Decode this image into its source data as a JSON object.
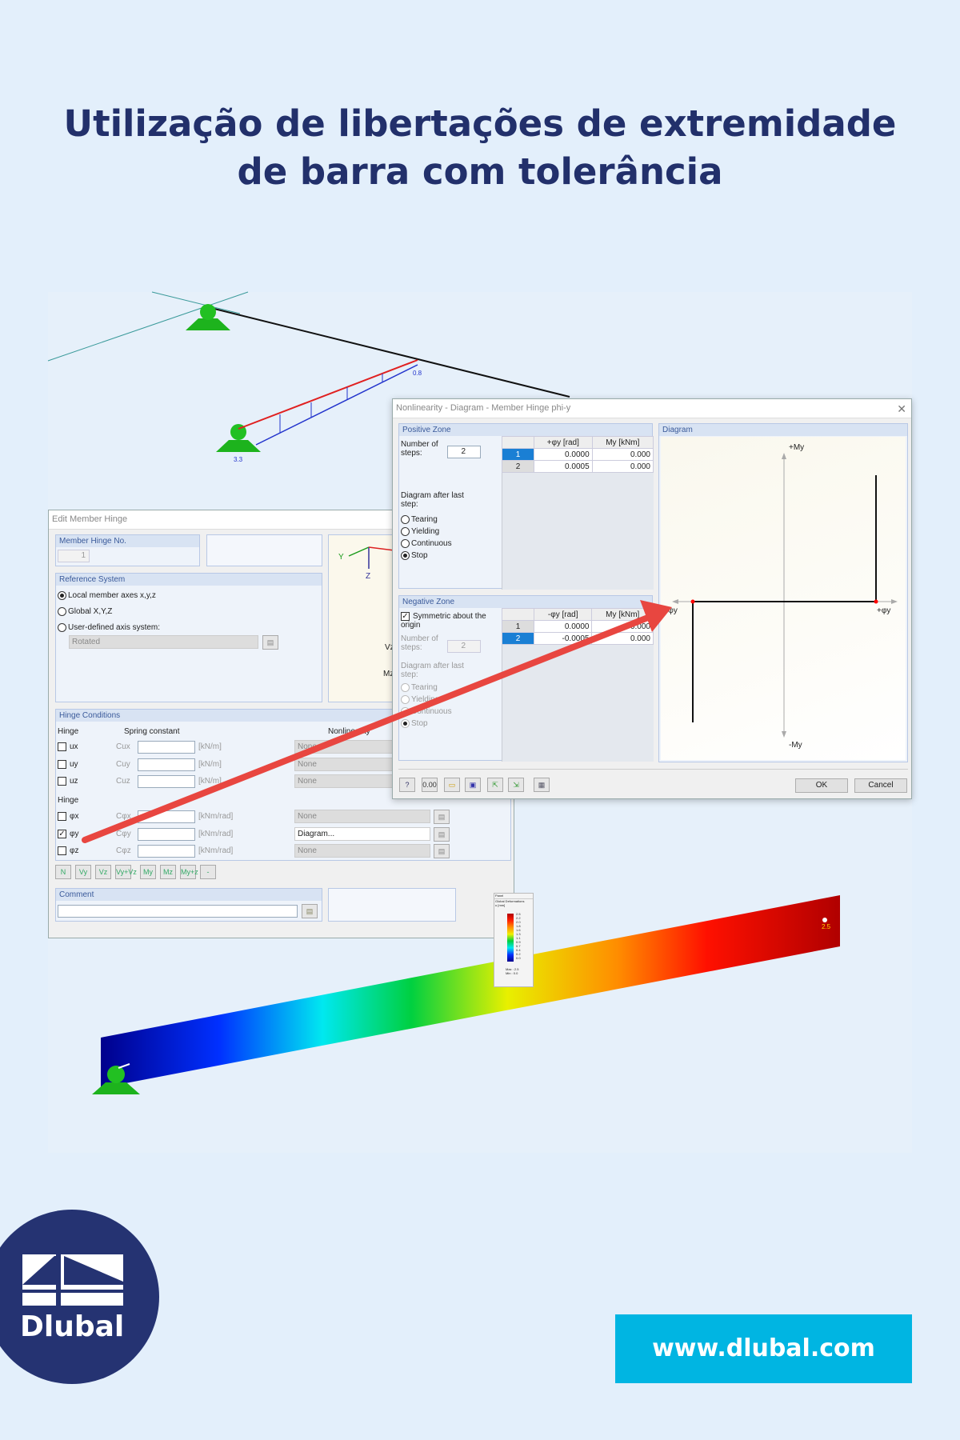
{
  "title": {
    "line1": "Utilização de libertações de extremidade",
    "line2": "de barra com tolerância"
  },
  "scene": {
    "load_label_right": "0.8",
    "load_label_left": "3.3",
    "max_label": "2.5"
  },
  "panel": {
    "title": "Panel",
    "heading": "Global Deformations",
    "unit": "u [mm]",
    "legend": [
      "2.5",
      "2.2",
      "2.0",
      "1.8",
      "1.6",
      "1.3",
      "1.1",
      "0.9",
      "0.7",
      "0.4",
      "0.2",
      "0.0"
    ],
    "max": "Max : 2.5",
    "min": "Min : 0.0"
  },
  "edit_hinge": {
    "title": "Edit Member Hinge",
    "hinge_no_label": "Member Hinge No.",
    "hinge_no": "1",
    "reference_system": "Reference System",
    "ref_options": [
      "Local member axes x,y,z",
      "Global X,Y,Z",
      "User-defined axis system:"
    ],
    "ref_selected": 0,
    "axis_select": "Rotated",
    "preview_labels": {
      "y": "Y",
      "z": "Z",
      "vz": "Vz",
      "mz": "Mz"
    },
    "hinge_conditions": "Hinge Conditions",
    "hinge_label": "Hinge",
    "spring_label": "Spring constant",
    "nonlinearity_label": "Nonlinearity",
    "rows": [
      {
        "name": "ux",
        "spring": "Cux",
        "unit": "[kN/m]",
        "checked": false,
        "nonlin": "None"
      },
      {
        "name": "uy",
        "spring": "Cuy",
        "unit": "[kN/m]",
        "checked": false,
        "nonlin": "None"
      },
      {
        "name": "uz",
        "spring": "Cuz",
        "unit": "[kN/m]",
        "checked": false,
        "nonlin": "None"
      },
      {
        "name": "φx",
        "spring": "Cφx",
        "unit": "[kNm/rad]",
        "checked": false,
        "nonlin": "None"
      },
      {
        "name": "φy",
        "spring": "Cφy",
        "unit": "[kNm/rad]",
        "checked": true,
        "nonlin": "Diagram..."
      },
      {
        "name": "φz",
        "spring": "Cφz",
        "unit": "[kNm/rad]",
        "checked": false,
        "nonlin": "None"
      }
    ],
    "toolbar": [
      "N",
      "Vy",
      "Vz",
      "Vy+Vz",
      "My",
      "Mz",
      "My+z",
      "-"
    ],
    "comment_label": "Comment",
    "comment_value": ""
  },
  "nonlin": {
    "title": "Nonlinearity - Diagram - Member Hinge phi-y",
    "positive": {
      "heading": "Positive Zone",
      "steps_label": "Number of steps:",
      "steps": "2",
      "columns": [
        "",
        "+φy [rad]",
        "My [kNm]"
      ],
      "rows": [
        [
          "1",
          "0.0000",
          "0.000"
        ],
        [
          "2",
          "0.0005",
          "0.000"
        ]
      ],
      "selected_row": 0,
      "after_label": "Diagram after last step:",
      "options": [
        "Tearing",
        "Yielding",
        "Continuous",
        "Stop"
      ],
      "selected": 3
    },
    "negative": {
      "heading": "Negative Zone",
      "symmetric_label": "Symmetric about the origin",
      "symmetric": true,
      "steps_label": "Number of steps:",
      "steps": "2",
      "columns": [
        "",
        "-φy [rad]",
        "My [kNm]"
      ],
      "rows": [
        [
          "1",
          "0.0000",
          "0.000"
        ],
        [
          "2",
          "-0.0005",
          "0.000"
        ]
      ],
      "selected_row": 1,
      "after_label": "Diagram after last step:",
      "options": [
        "Tearing",
        "Yielding",
        "Continuous",
        "Stop"
      ],
      "selected": 3
    },
    "diagram": {
      "heading": "Diagram",
      "plus_m": "+My",
      "minus_m": "-My",
      "plus_phi": "+φy",
      "minus_phi": "-φy"
    },
    "ok": "OK",
    "cancel": "Cancel"
  },
  "brand": {
    "name": "Dlubal",
    "url": "www.dlubal.com",
    "color": "#00b5e2",
    "navy": "#253372"
  }
}
